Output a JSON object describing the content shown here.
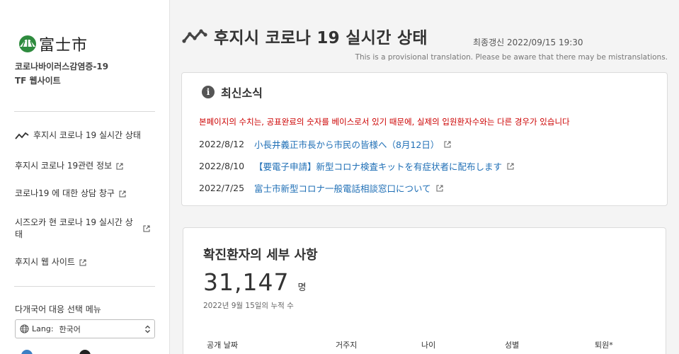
{
  "sidebar": {
    "logo_text": "富士市",
    "site_name_line1": "코로나바이러스감염증-19",
    "site_name_line2": "TF 웹사이트",
    "items": [
      {
        "label": "후지시 코로나 19 실시간 상태",
        "icon": "trend-icon"
      },
      {
        "label": "후지시 코로나 19관련 정보",
        "icon": "external-link-icon"
      },
      {
        "label": "코로나19 에 대한 상담 창구",
        "icon": "external-link-icon"
      },
      {
        "label": "시즈오카 현 코로나 19 실시간 상태",
        "icon": "external-link-icon"
      },
      {
        "label": "후지시 웹 사이트",
        "icon": "external-link-icon"
      }
    ],
    "language_menu_label": "다개국어 대응 선택 메뉴",
    "language_select": {
      "prefix": "Lang:",
      "selected": "한국어"
    }
  },
  "header": {
    "title": "후지시 코로나 19 실시간 상태",
    "updated": "최종갱신 2022/09/15 19:30",
    "translation_note": "This is a provisional translation. Please be aware that there may be mistranslations."
  },
  "news": {
    "title": "최신소식",
    "notice": "본페이지의 수치는, 공표완료의 숫자를 베이스로서 있기 때문에, 실제의 입원환자수와는 다른 경우가 있습니다",
    "items": [
      {
        "date": "2022/8/12",
        "text": "小長井義正市長から市民の皆様へ（8月12日）"
      },
      {
        "date": "2022/8/10",
        "text": "【要電子申請】新型コロナ検査キットを有症状者に配布します"
      },
      {
        "date": "2022/7/25",
        "text": "富士市新型コロナ一般電話相談窓口について"
      }
    ]
  },
  "details": {
    "title": "확진환자의 세부 사항",
    "count": "31,147",
    "unit": "명",
    "note": "2022년 9월 15일의 누적 수",
    "columns": [
      "공개 날짜",
      "거주지",
      "나이",
      "성별",
      "퇴원*"
    ]
  },
  "colors": {
    "link": "#1f6fb6",
    "notice": "#cc0000",
    "logo_green": "#2e8b3e"
  }
}
